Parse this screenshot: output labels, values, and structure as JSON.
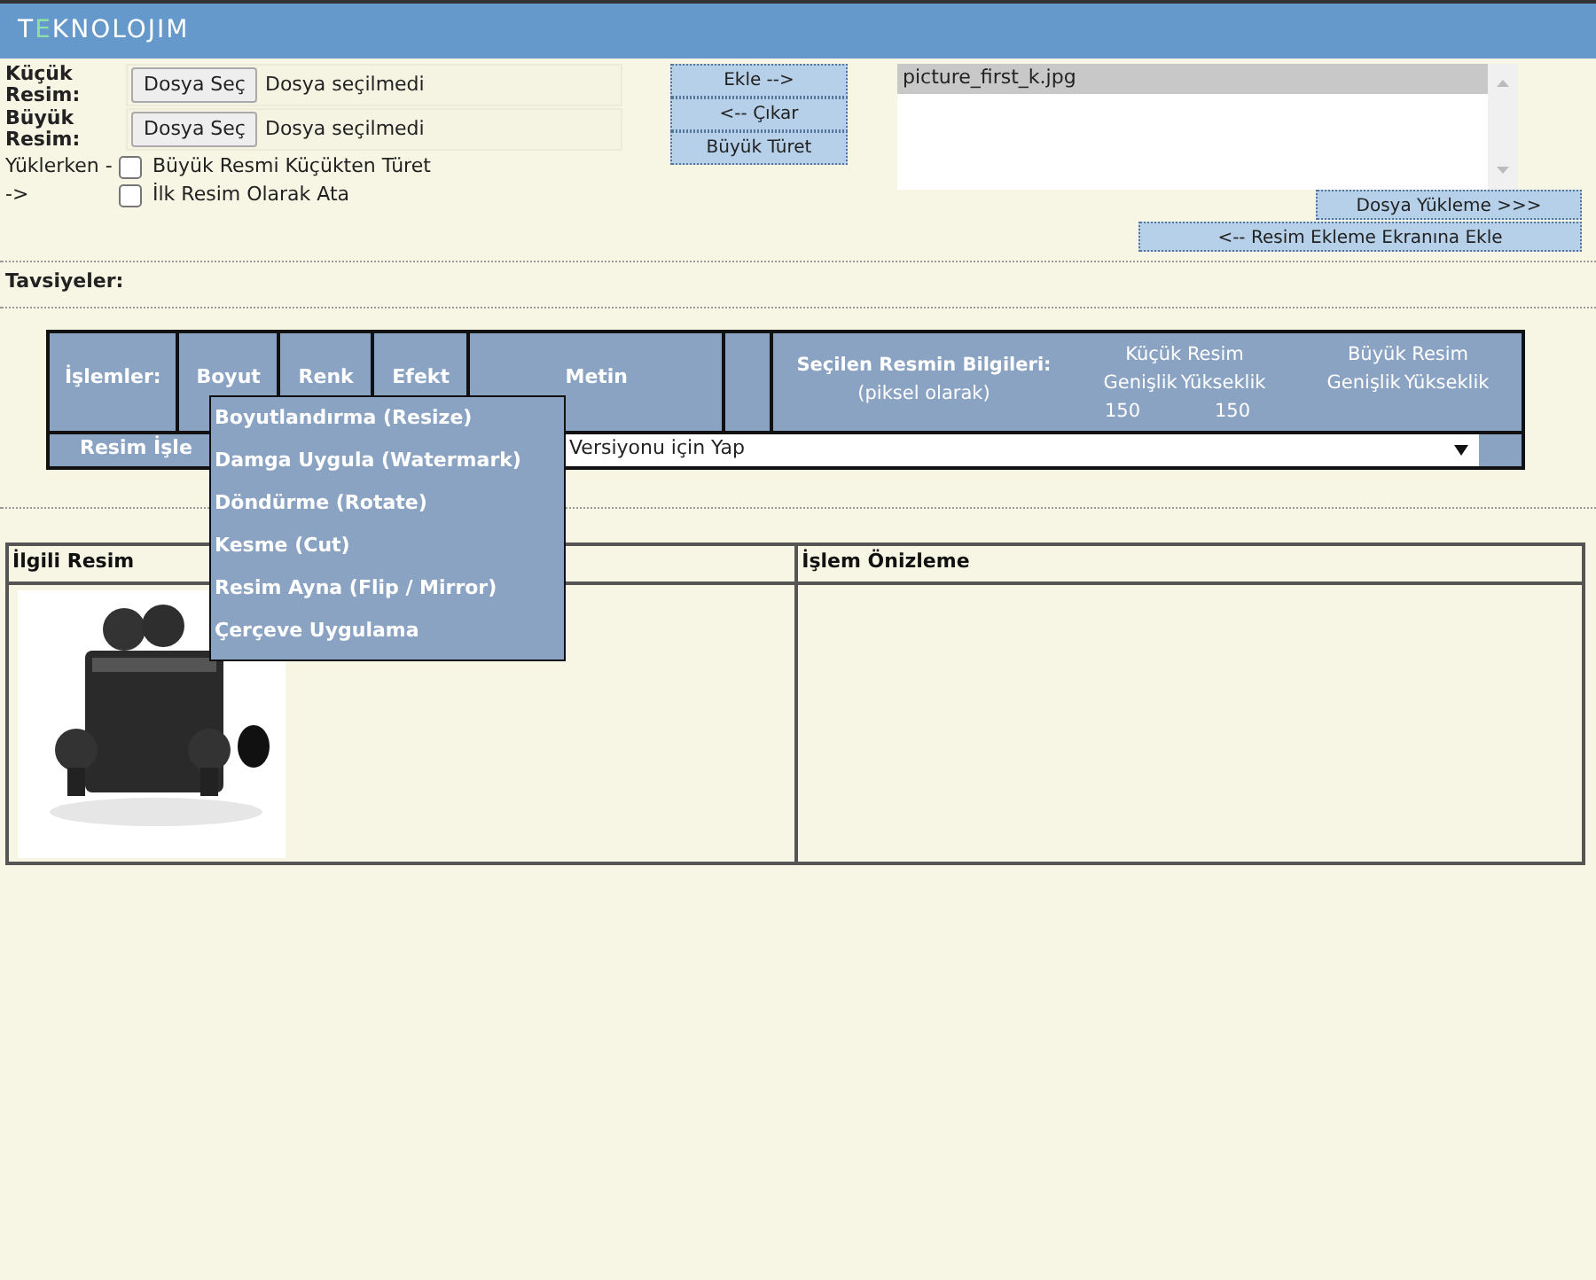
{
  "header": {
    "logo": "TEKNOLOJIM"
  },
  "upload": {
    "rows": [
      {
        "label": "Küçük Resim:",
        "button": "Dosya Seç",
        "status": "Dosya seçilmedi"
      },
      {
        "label": "Büyük Resim:",
        "button": "Dosya Seç",
        "status": "Dosya seçilmedi"
      }
    ],
    "options_label": "Yüklerken -->",
    "options": [
      {
        "label": "Büyük Resmi Küçükten Türet",
        "checked": false
      },
      {
        "label": "İlk Resim Olarak Ata",
        "checked": false
      }
    ]
  },
  "actions": [
    "Ekle -->",
    "<-- Çıkar",
    "Büyük Türet"
  ],
  "file_list": {
    "items": [
      {
        "label": "picture_first_k.jpg",
        "selected": true
      }
    ]
  },
  "upload_buttons": [
    "Dosya Yükleme >>>",
    "<-- Resim Ekleme Ekranına Ekle"
  ],
  "recommendations_label": "Tavsiyeler:",
  "operations": {
    "label": "İşlemler:",
    "tabs": [
      "Boyut",
      "Renk",
      "Efekt",
      "Metin"
    ],
    "info": {
      "title": "Seçilen Resmin Bilgileri:",
      "subtitle": "(piksel olarak)",
      "groups": [
        {
          "title": "Küçük Resim",
          "columns": [
            "Genişlik",
            "Yükseklik"
          ],
          "values": [
            "150",
            "150"
          ]
        },
        {
          "title": "Büyük Resim",
          "columns": [
            "Genişlik",
            "Yükseklik"
          ]
        }
      ]
    },
    "apply_label": "Resim İşle",
    "apply_select": "Versiyonu için Yap",
    "menu": [
      "Boyutlandırma (Resize)",
      "Damga Uygula (Watermark)",
      "Döndürme (Rotate)",
      "Kesme (Cut)",
      "Resim Ayna (Flip / Mirror)",
      "Çerçeve Uygulama"
    ]
  },
  "preview": {
    "columns": [
      "İlgili Resim",
      "İşlem Önizleme"
    ],
    "image": {
      "kind": "picture"
    }
  }
}
